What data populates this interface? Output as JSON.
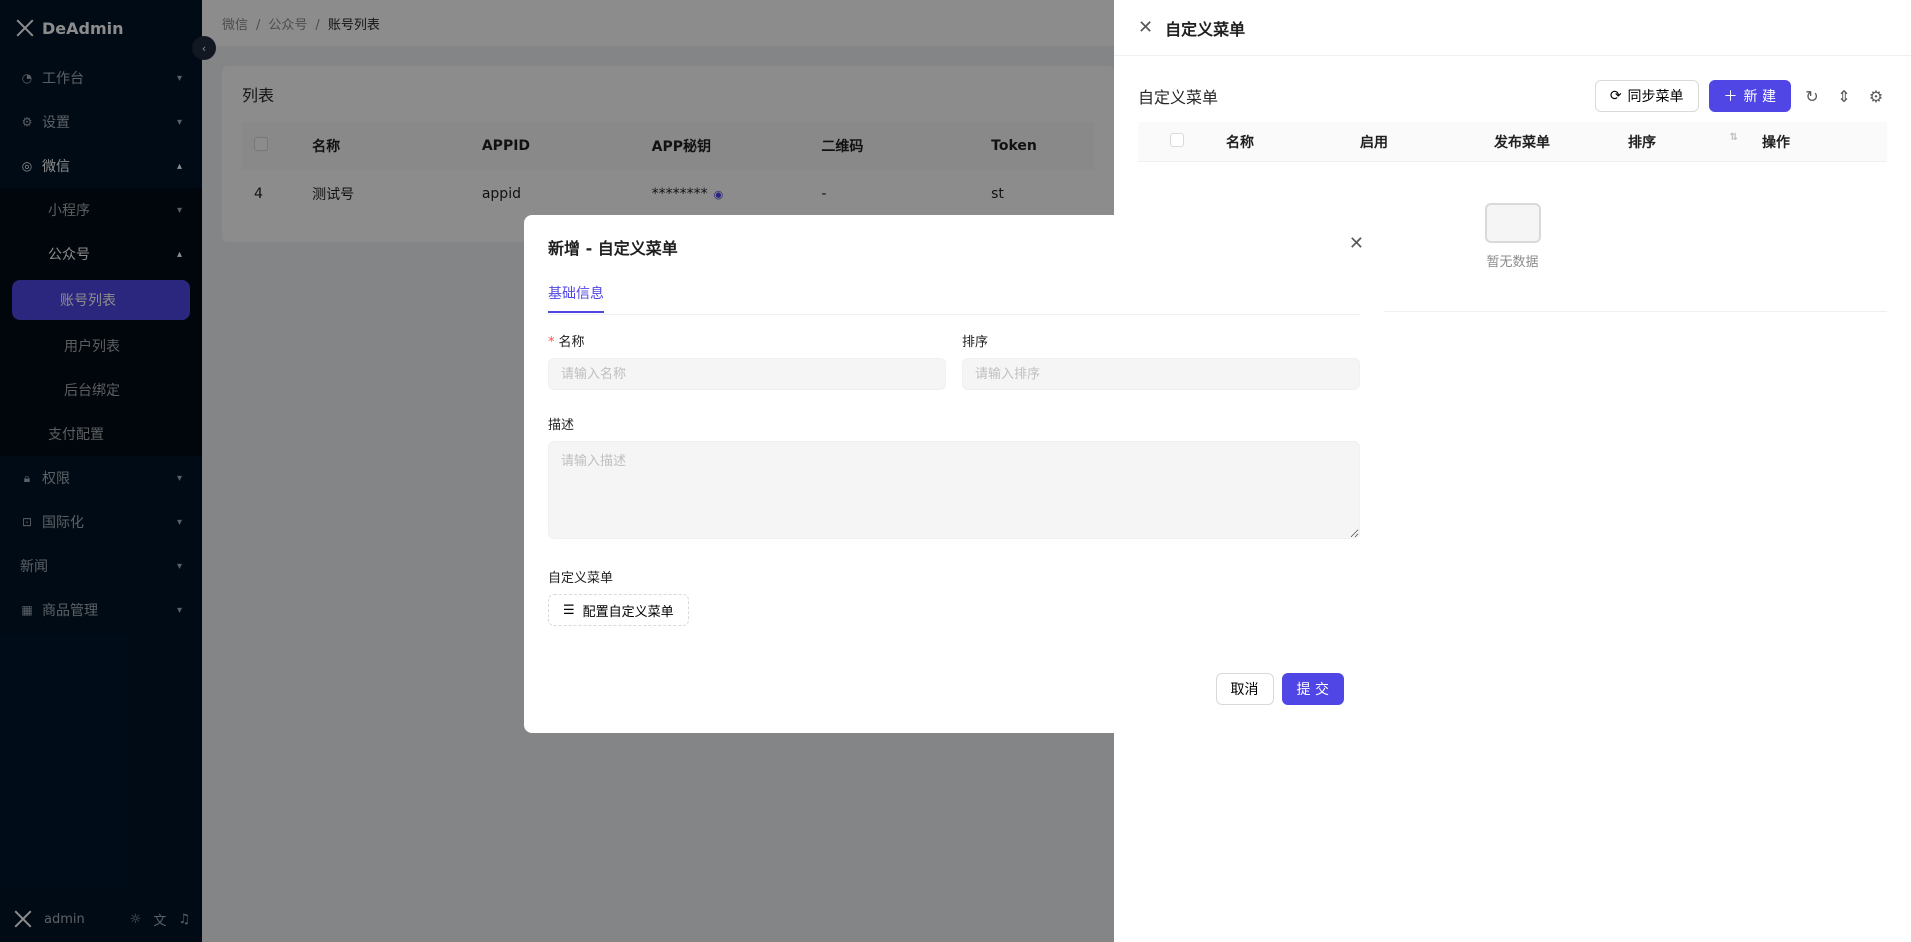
{
  "app": {
    "name": "DeAdmin"
  },
  "sidebar": {
    "items": [
      {
        "label": "工作台",
        "icon": "dashboard-icon"
      },
      {
        "label": "设置",
        "icon": "gear-icon"
      },
      {
        "label": "微信",
        "icon": "wechat-icon"
      },
      {
        "label": "小程序"
      },
      {
        "label": "公众号"
      },
      {
        "label": "账号列表"
      },
      {
        "label": "用户列表"
      },
      {
        "label": "后台绑定"
      },
      {
        "label": "支付配置"
      },
      {
        "label": "权限",
        "icon": "lock-icon"
      },
      {
        "label": "国际化",
        "icon": "translate-icon"
      },
      {
        "label": "新闻"
      },
      {
        "label": "商品管理",
        "icon": "table-icon"
      }
    ],
    "user": "admin"
  },
  "breadcrumb": [
    "微信",
    "公众号",
    "账号列表"
  ],
  "list": {
    "title": "列表",
    "columns": [
      "名称",
      "APPID",
      "APP秘钥",
      "二维码",
      "Token"
    ],
    "rows": [
      {
        "id": "4",
        "name": "测试号",
        "appid": "appid",
        "secret": "********",
        "qrcode": "-",
        "token": "st"
      }
    ]
  },
  "drawer": {
    "title": "自定义菜单",
    "table_title": "自定义菜单",
    "sync_label": "同步菜单",
    "new_label": "新 建",
    "columns": [
      "名称",
      "启用",
      "发布菜单",
      "排序",
      "操作"
    ],
    "empty_text": "暂无数据"
  },
  "modal": {
    "title": "新增 - 自定义菜单",
    "tab": "基础信息",
    "name_label": "名称",
    "name_placeholder": "请输入名称",
    "sort_label": "排序",
    "sort_placeholder": "请输入排序",
    "desc_label": "描述",
    "desc_placeholder": "请输入描述",
    "menu_label": "自定义菜单",
    "menu_button": "配置自定义菜单",
    "cancel": "取消",
    "submit": "提 交"
  },
  "colors": {
    "primary": "#4f46e5",
    "sidebar": "#001529"
  }
}
